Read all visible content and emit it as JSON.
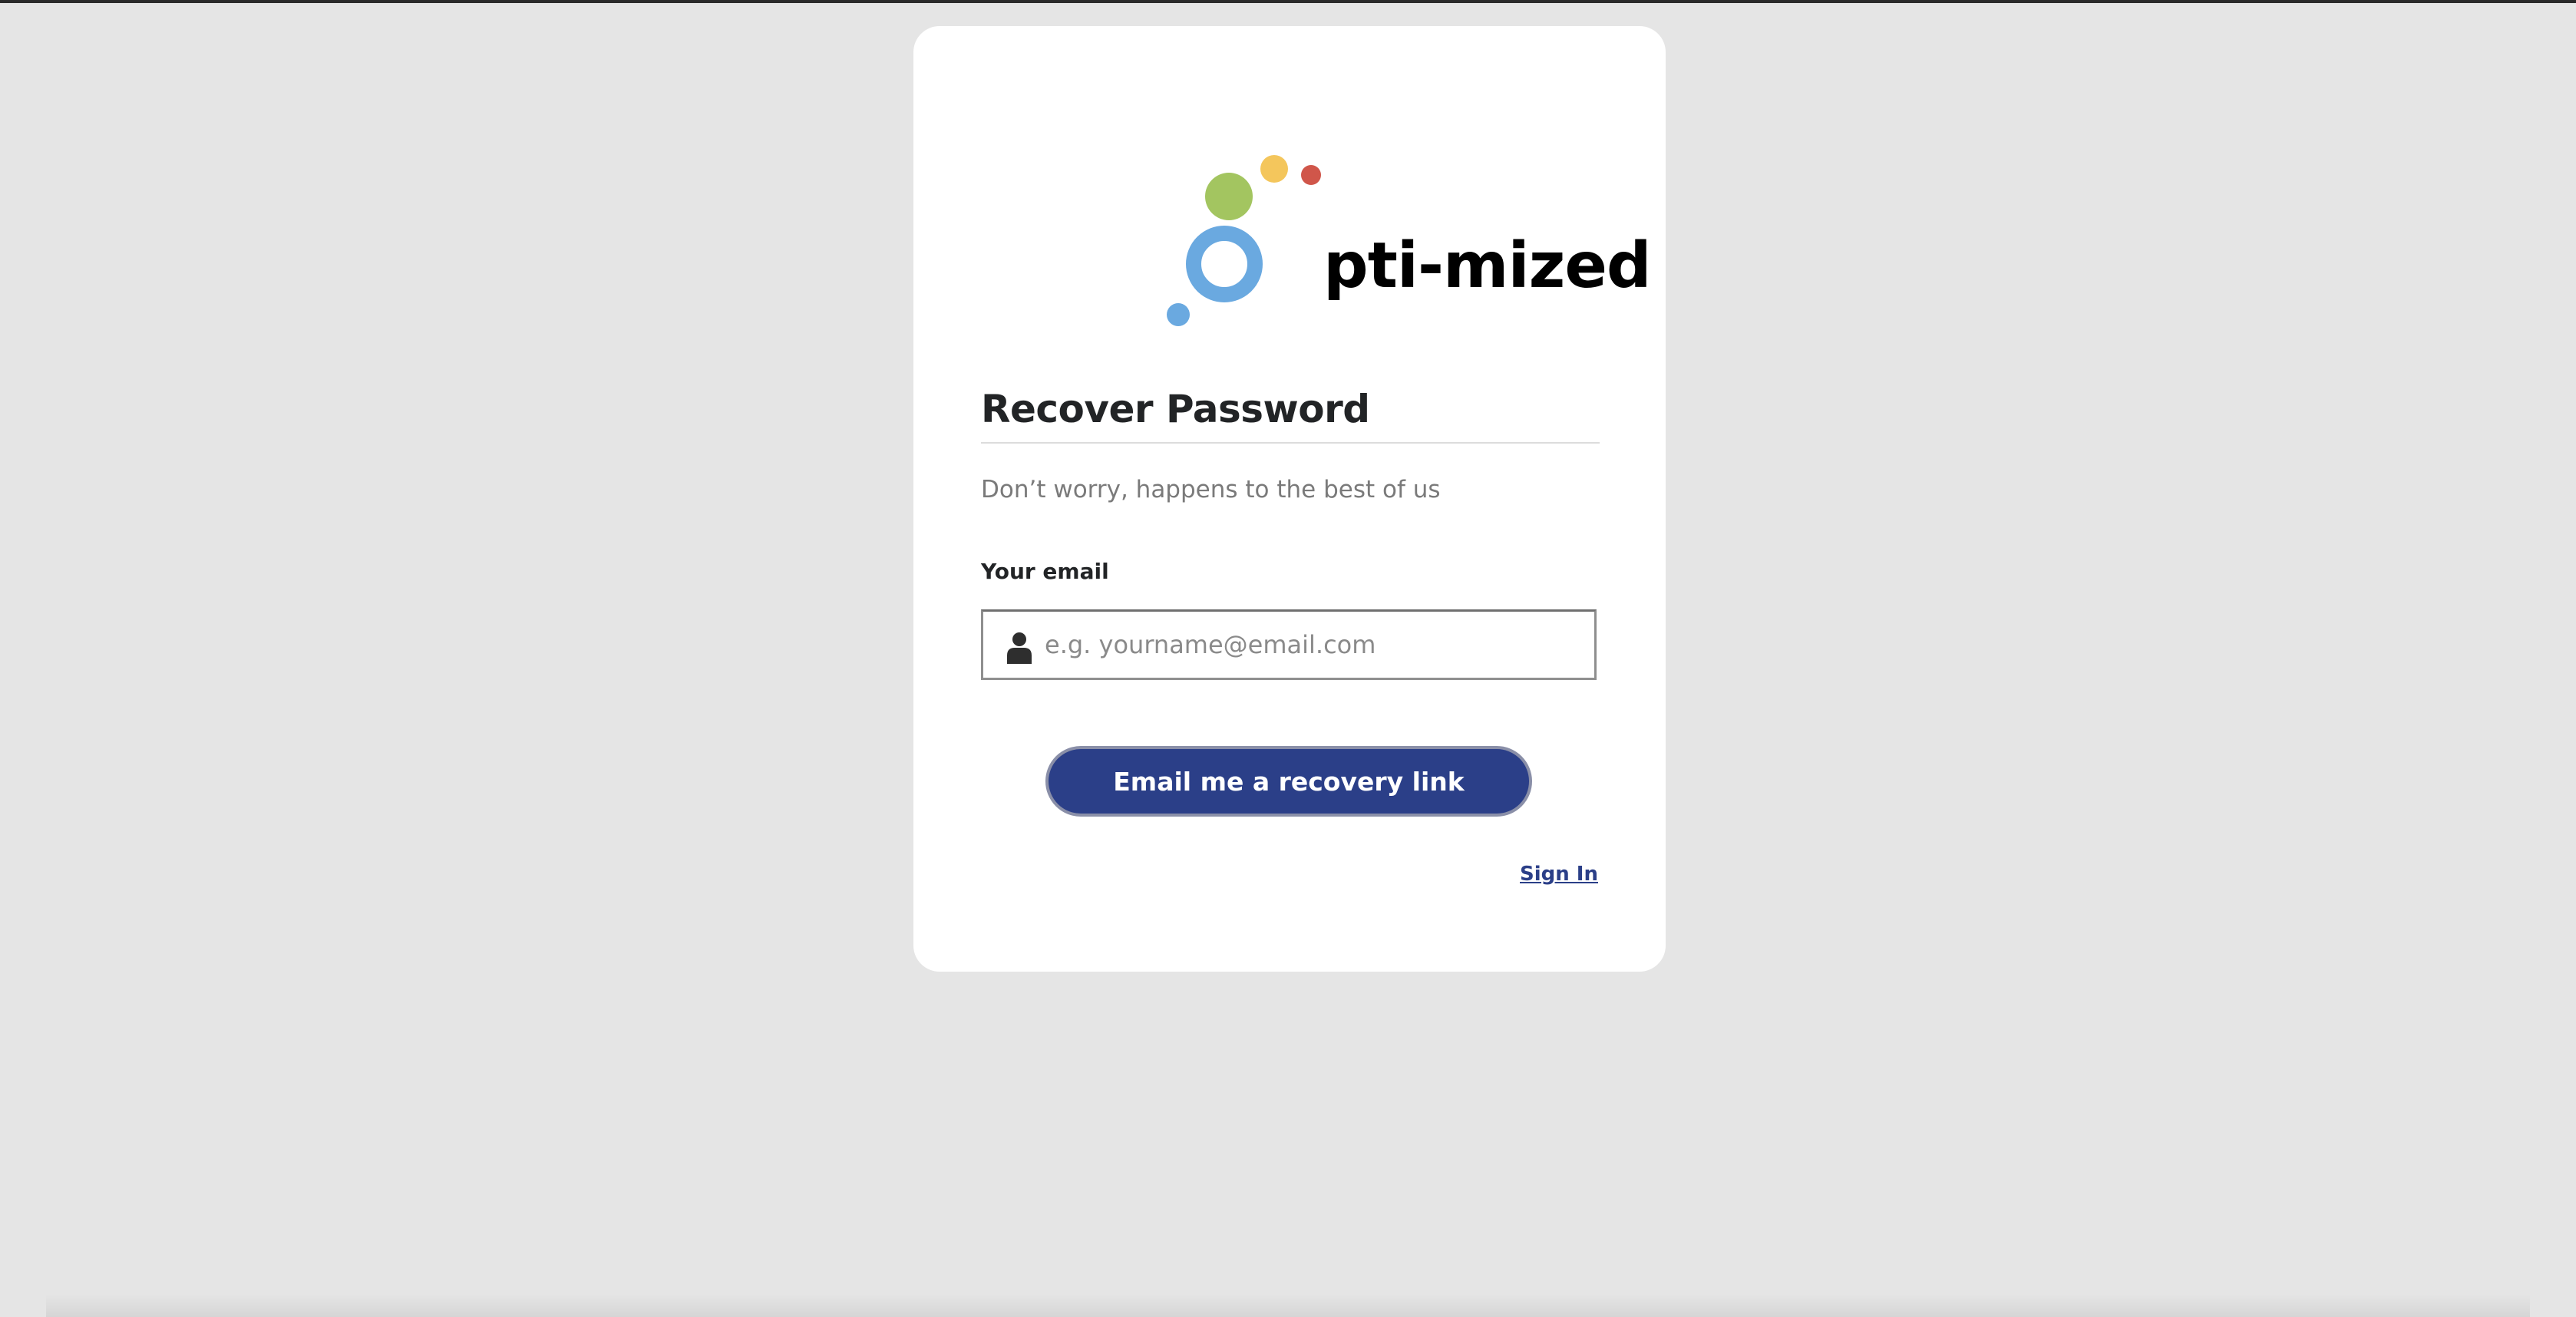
{
  "brand": {
    "name": "Opti-mized",
    "wordmark_rest": "pti-mized",
    "colors": {
      "blue": "#6aa9e0",
      "green": "#a3c560",
      "yellow": "#f4c65c",
      "red": "#d0564a"
    }
  },
  "form": {
    "title": "Recover Password",
    "subtitle": "Don’t worry, happens to the best of us",
    "email_label": "Your email",
    "email_placeholder": "e.g. yourname@email.com",
    "email_value": "",
    "user_icon": "user-icon",
    "submit_label": "Email me a recovery link",
    "signin_label": "Sign In"
  },
  "colors": {
    "background": "#e5e5e5",
    "card": "#ffffff",
    "primary": "#2b3f88",
    "heading": "#222426",
    "muted": "#7a7a7a"
  }
}
